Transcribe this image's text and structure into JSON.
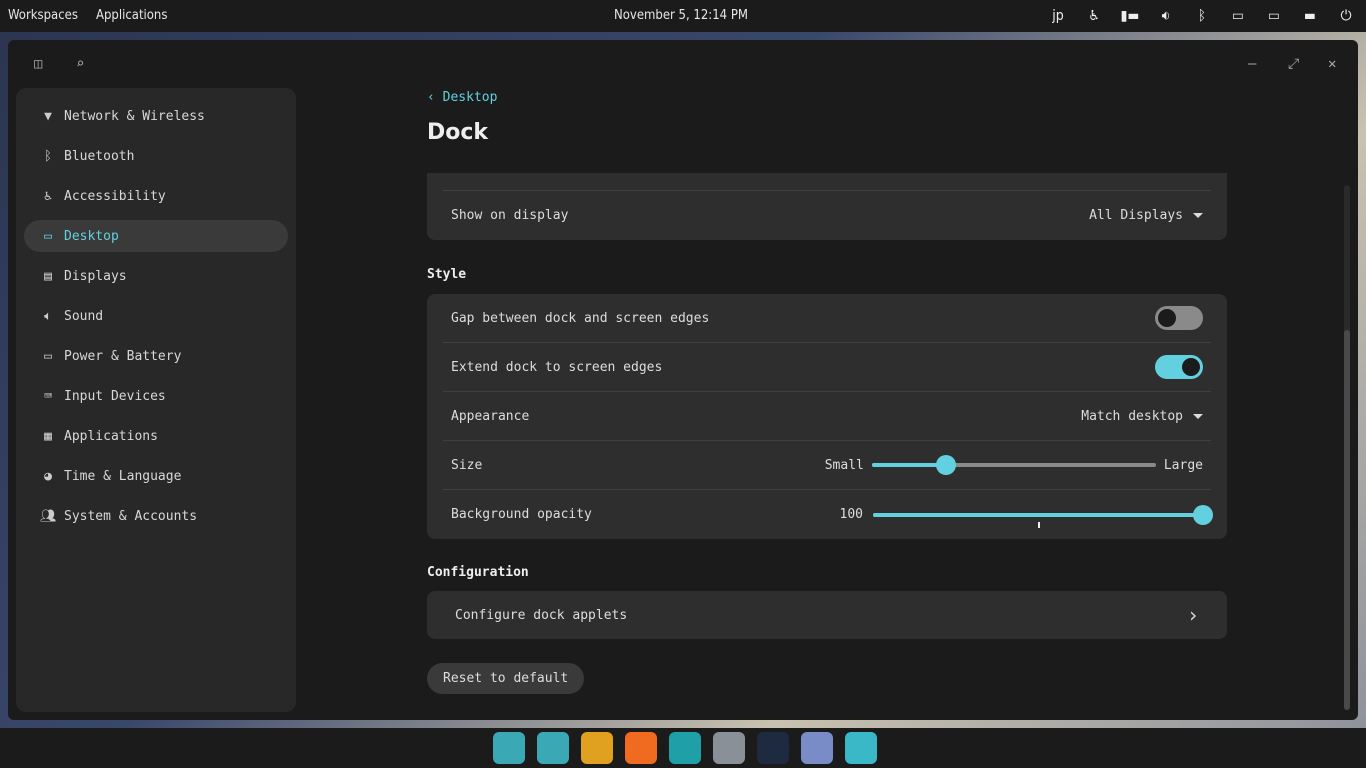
{
  "panel": {
    "workspaces": "Workspaces",
    "applications": "Applications",
    "clock": "November 5, 12:14 PM",
    "input_method": "jp",
    "tray_icons": [
      "accessibility-icon",
      "workspaces-icon",
      "volume-icon",
      "bluetooth-off-icon",
      "network-icon",
      "battery-icon",
      "notifications-icon",
      "power-icon"
    ]
  },
  "sidebar": {
    "items": [
      {
        "label": "Network & Wireless",
        "icon": "wifi-icon"
      },
      {
        "label": "Bluetooth",
        "icon": "bluetooth-icon"
      },
      {
        "label": "Accessibility",
        "icon": "accessibility-icon"
      },
      {
        "label": "Desktop",
        "icon": "desktop-icon",
        "active": true
      },
      {
        "label": "Displays",
        "icon": "displays-icon"
      },
      {
        "label": "Sound",
        "icon": "sound-icon"
      },
      {
        "label": "Power & Battery",
        "icon": "battery-icon"
      },
      {
        "label": "Input Devices",
        "icon": "keyboard-icon"
      },
      {
        "label": "Applications",
        "icon": "apps-icon"
      },
      {
        "label": "Time & Language",
        "icon": "globe-icon"
      },
      {
        "label": "System & Accounts",
        "icon": "users-icon"
      }
    ]
  },
  "main": {
    "back": "Desktop",
    "title": "Dock",
    "show_on_display": {
      "label": "Show on display",
      "value": "All Displays"
    },
    "style": {
      "heading": "Style",
      "gap": {
        "label": "Gap between dock and screen edges",
        "on": false
      },
      "extend": {
        "label": "Extend dock to screen edges",
        "on": true
      },
      "appearance": {
        "label": "Appearance",
        "value": "Match desktop"
      },
      "size": {
        "label": "Size",
        "min_label": "Small",
        "max_label": "Large",
        "value_fraction": 0.26
      },
      "opacity": {
        "label": "Background opacity",
        "value": "100",
        "value_fraction": 1.0
      }
    },
    "configuration": {
      "heading": "Configuration",
      "applets": "Configure dock applets"
    },
    "reset": "Reset to default"
  },
  "dock": [
    "app-library",
    "workspaces",
    "launcher",
    "firefox",
    "files",
    "text-editor",
    "terminal",
    "store",
    "settings"
  ],
  "colors": {
    "accent": "#63d0df"
  }
}
